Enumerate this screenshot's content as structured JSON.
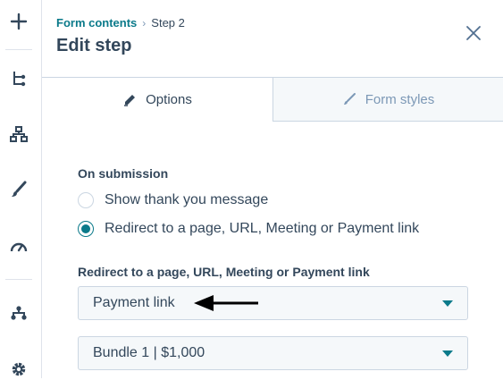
{
  "breadcrumb": {
    "parent": "Form contents",
    "separator": "›",
    "current": "Step 2"
  },
  "header": {
    "title": "Edit step"
  },
  "tabs": [
    {
      "label": "Options",
      "icon": "pencil-icon",
      "active": true
    },
    {
      "label": "Form styles",
      "icon": "brush-icon",
      "active": false
    }
  ],
  "on_submission": {
    "label": "On submission",
    "options": [
      {
        "label": "Show thank you message",
        "checked": false
      },
      {
        "label": "Redirect to a page, URL, Meeting or Payment link",
        "checked": true
      }
    ]
  },
  "redirect": {
    "label": "Redirect to a page, URL, Meeting or Payment link",
    "type_select_value": "Payment link",
    "item_select_value": "Bundle 1 | $1,000"
  },
  "sidebar": {
    "icons": [
      "add-icon",
      "tree-icon",
      "hierarchy-icon",
      "brush-icon",
      "gauge-icon",
      "workflow-icon",
      "settings-icon"
    ]
  },
  "colors": {
    "accent": "#0b7a8a",
    "text": "#33475b",
    "muted": "#7c98b6",
    "border": "#cbd6e2"
  }
}
